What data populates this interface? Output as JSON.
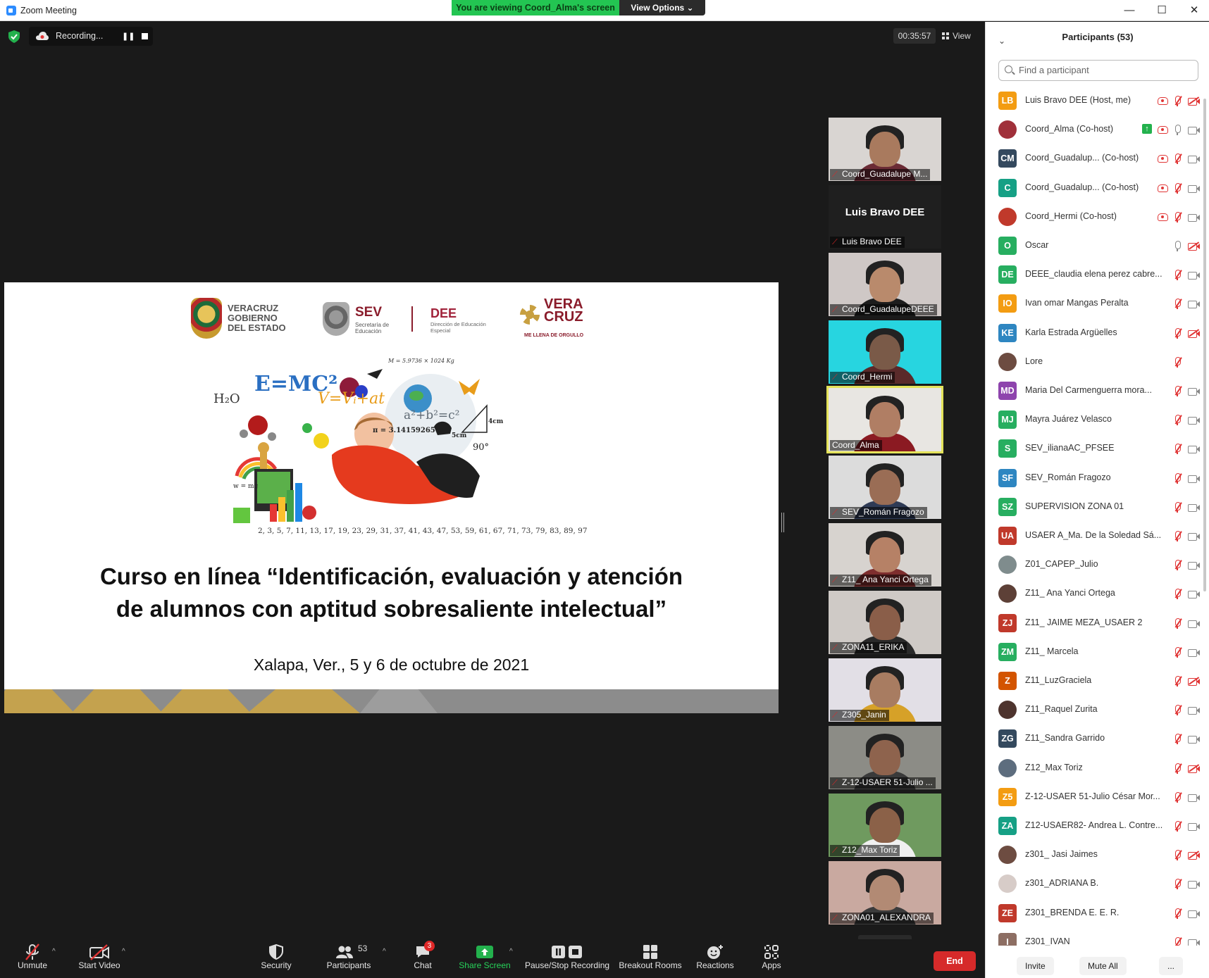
{
  "window": {
    "title": "Zoom Meeting",
    "minimize": "—",
    "maximize": "☐",
    "close": "✕"
  },
  "banner": {
    "viewing": "You are viewing Coord_Alma's screen",
    "view_options": "View Options ⌄"
  },
  "meeting": {
    "recording_label": "Recording...",
    "timer": "00:35:57",
    "view_label": "View"
  },
  "slide": {
    "logo_veracruz": "VERACRUZ GOBIERNO DEL ESTADO",
    "logo_sev": "SEV",
    "logo_sev_sub": "Secretaría de Educación",
    "logo_dee": "DEE",
    "logo_dee_sub": "Dirección de Educación Especial",
    "logo_vera": "VERA CRUZ",
    "logo_vera_tag": "ME LLENA DE ORGULLO",
    "ill_emc": "E=MC²",
    "ill_h2o": "H₂O",
    "ill_v": "V=Vᵢ+at",
    "ill_pi": "π = 3.14159265",
    "ill_pyth": "a²+b²=c²",
    "ill_mass": "M = 5.9736 × 1024 Kg",
    "ill_4cm": "4cm",
    "ill_5cm": "5cm",
    "ill_90": "90°",
    "ill_w": "w = mg",
    "ill_primes": "2, 3, 5, 7, 11, 13, 17, 19, 23, 29, 31, 37, 41, 43, 47, 53, 59, 61, 67, 71, 73, 79, 83, 89, 97",
    "title_line1": "Curso en línea “Identificación, evaluación y atención",
    "title_line2": "de alumnos con aptitud sobresaliente intelectual”",
    "date": "Xalapa, Ver., 5 y 6 de octubre de 2021"
  },
  "gallery": [
    {
      "name": "Coord_Guadalupe M...",
      "muted": true,
      "video": true,
      "skin": "#a97a5e",
      "shirt": "#6b2b35",
      "bg": "#d9d5d2"
    },
    {
      "name": "Luis Bravo DEE",
      "muted": true,
      "video": false,
      "big": "Luis Bravo DEE"
    },
    {
      "name": "Coord_GuadalupeDEEE",
      "muted": true,
      "video": true,
      "skin": "#b98a6c",
      "shirt": "#1d1d1d",
      "bg": "#cfc8c6"
    },
    {
      "name": "Coord_Hermi",
      "muted": true,
      "video": true,
      "skin": "#7a5a48",
      "shirt": "#5a2a2a",
      "bg": "#27d5e0"
    },
    {
      "name": "Coord_Alma",
      "muted": false,
      "video": true,
      "active": true,
      "skin": "#b07e64",
      "shirt": "#8b1a22",
      "bg": "#e8e6e2"
    },
    {
      "name": "SEV_Román Fragozo",
      "muted": true,
      "video": true,
      "skin": "#9a6d55",
      "shirt": "#2f3b56",
      "bg": "#dcdcdc"
    },
    {
      "name": "Z11_ Ana Yanci Ortega",
      "muted": true,
      "video": true,
      "skin": "#b68166",
      "shirt": "#7e2e2e",
      "bg": "#d7d3cf"
    },
    {
      "name": "ZONA11_ERIKA",
      "muted": true,
      "video": true,
      "skin": "#8a5e49",
      "shirt": "#2a2a2a",
      "bg": "#cfcac6"
    },
    {
      "name": "Z305_Janin",
      "muted": true,
      "video": true,
      "skin": "#a87c61",
      "shirt": "#d6a128",
      "bg": "#e2dfe6"
    },
    {
      "name": "Z-12-USAER 51-Julio ...",
      "muted": true,
      "video": true,
      "skin": "#8e634d",
      "shirt": "#3a3a3a",
      "bg": "#8c8c86"
    },
    {
      "name": "Z12_Max Toriz",
      "muted": true,
      "video": true,
      "skin": "#8b6148",
      "shirt": "#f0f0f0",
      "bg": "#6f9a5f"
    },
    {
      "name": "ZONA01_ALEXANDRA",
      "muted": true,
      "video": true,
      "skin": "#b28a74",
      "shirt": "#3b3b3b",
      "bg": "#c9a9a0"
    }
  ],
  "toolbar": {
    "unmute": "Unmute",
    "start_video": "Start Video",
    "security": "Security",
    "participants": "Participants",
    "participants_count": "53",
    "chat": "Chat",
    "chat_badge": "3",
    "share_screen": "Share Screen",
    "pause_stop": "Pause/Stop Recording",
    "breakout": "Breakout Rooms",
    "reactions": "Reactions",
    "apps": "Apps",
    "end": "End"
  },
  "panel": {
    "title": "Participants (53)",
    "search_placeholder": "Find a participant",
    "invite": "Invite",
    "mute_all": "Mute All",
    "more": "...",
    "participants": [
      {
        "initials": "LB",
        "color": "#f39c12",
        "name": "Luis Bravo DEE (Host, me)",
        "rec": true,
        "mic": "off",
        "cam": "off"
      },
      {
        "initials": "",
        "color": "#a0303a",
        "photo": true,
        "name": "Coord_Alma (Co-host)",
        "share": true,
        "rec": true,
        "mic": "on",
        "cam": "on"
      },
      {
        "initials": "CM",
        "color": "#34495e",
        "name": "Coord_Guadalup...  (Co-host)",
        "rec": true,
        "mic": "off",
        "cam": "on"
      },
      {
        "initials": "C",
        "color": "#16a085",
        "name": "Coord_Guadalup...  (Co-host)",
        "rec": true,
        "mic": "off",
        "cam": "on"
      },
      {
        "initials": "",
        "color": "#c0392b",
        "photo": true,
        "name": "Coord_Hermi (Co-host)",
        "rec": true,
        "mic": "off",
        "cam": "on"
      },
      {
        "initials": "O",
        "color": "#27ae60",
        "name": "Oscar",
        "mic": "on",
        "cam": "off"
      },
      {
        "initials": "DE",
        "color": "#27ae60",
        "name": "DEEE_claudia elena perez cabre...",
        "mic": "off",
        "cam": "on"
      },
      {
        "initials": "IO",
        "color": "#f39c12",
        "name": "Ivan omar Mangas Peralta",
        "mic": "off",
        "cam": "on"
      },
      {
        "initials": "KE",
        "color": "#2e86c1",
        "name": "Karla Estrada Argüelles",
        "mic": "off",
        "cam": "off"
      },
      {
        "initials": "",
        "color": "#6d4c41",
        "photo": true,
        "name": "Lore",
        "mic": "off",
        "cam": "none"
      },
      {
        "initials": "MD",
        "color": "#8e44ad",
        "name": "Maria Del Carmenguerra mora...",
        "mic": "off",
        "cam": "on"
      },
      {
        "initials": "MJ",
        "color": "#27ae60",
        "name": "Mayra Juárez Velasco",
        "mic": "off",
        "cam": "on"
      },
      {
        "initials": "S",
        "color": "#27ae60",
        "name": "SEV_ilianaAC_PFSEE",
        "mic": "off",
        "cam": "on"
      },
      {
        "initials": "SF",
        "color": "#2e86c1",
        "name": "SEV_Román Fragozo",
        "mic": "off",
        "cam": "on"
      },
      {
        "initials": "SZ",
        "color": "#27ae60",
        "name": "SUPERVISION ZONA 01",
        "mic": "off",
        "cam": "on"
      },
      {
        "initials": "UA",
        "color": "#c0392b",
        "name": "USAER A_Ma. De la Soledad Sá...",
        "mic": "off",
        "cam": "on"
      },
      {
        "initials": "",
        "color": "#7f8c8d",
        "photo": true,
        "name": "Z01_CAPEP_Julio",
        "mic": "off",
        "cam": "on"
      },
      {
        "initials": "",
        "color": "#5d4037",
        "photo": true,
        "name": "Z11_ Ana Yanci Ortega",
        "mic": "off",
        "cam": "on"
      },
      {
        "initials": "ZJ",
        "color": "#c0392b",
        "name": "Z11_ JAIME MEZA_USAER 2",
        "mic": "off",
        "cam": "on"
      },
      {
        "initials": "ZM",
        "color": "#27ae60",
        "name": "Z11_ Marcela",
        "mic": "off",
        "cam": "on"
      },
      {
        "initials": "Z",
        "color": "#d35400",
        "name": "Z11_LuzGraciela",
        "mic": "off",
        "cam": "off"
      },
      {
        "initials": "",
        "color": "#4e342e",
        "photo": true,
        "name": "Z11_Raquel Zurita",
        "mic": "off",
        "cam": "on"
      },
      {
        "initials": "ZG",
        "color": "#34495e",
        "name": "Z11_Sandra Garrido",
        "mic": "off",
        "cam": "on"
      },
      {
        "initials": "",
        "color": "#5d6d7e",
        "photo": true,
        "name": "Z12_Max Toriz",
        "mic": "off",
        "cam": "off"
      },
      {
        "initials": "Z5",
        "color": "#f39c12",
        "name": "Z-12-USAER 51-Julio César Mor...",
        "mic": "off",
        "cam": "on"
      },
      {
        "initials": "ZA",
        "color": "#16a085",
        "name": "Z12-USAER82- Andrea L. Contre...",
        "mic": "off",
        "cam": "on"
      },
      {
        "initials": "",
        "color": "#6d4c41",
        "photo": true,
        "name": "z301_ Jasi Jaimes",
        "mic": "off",
        "cam": "off"
      },
      {
        "initials": "",
        "color": "#d7ccc8",
        "photo": true,
        "name": "z301_ADRIANA B.",
        "mic": "off",
        "cam": "on"
      },
      {
        "initials": "ZE",
        "color": "#c0392b",
        "name": "Z301_BRENDA E. E. R.",
        "mic": "off",
        "cam": "on"
      },
      {
        "initials": "I",
        "color": "#8d6e63",
        "name": "Z301_IVAN",
        "mic": "off",
        "cam": "on"
      }
    ]
  }
}
